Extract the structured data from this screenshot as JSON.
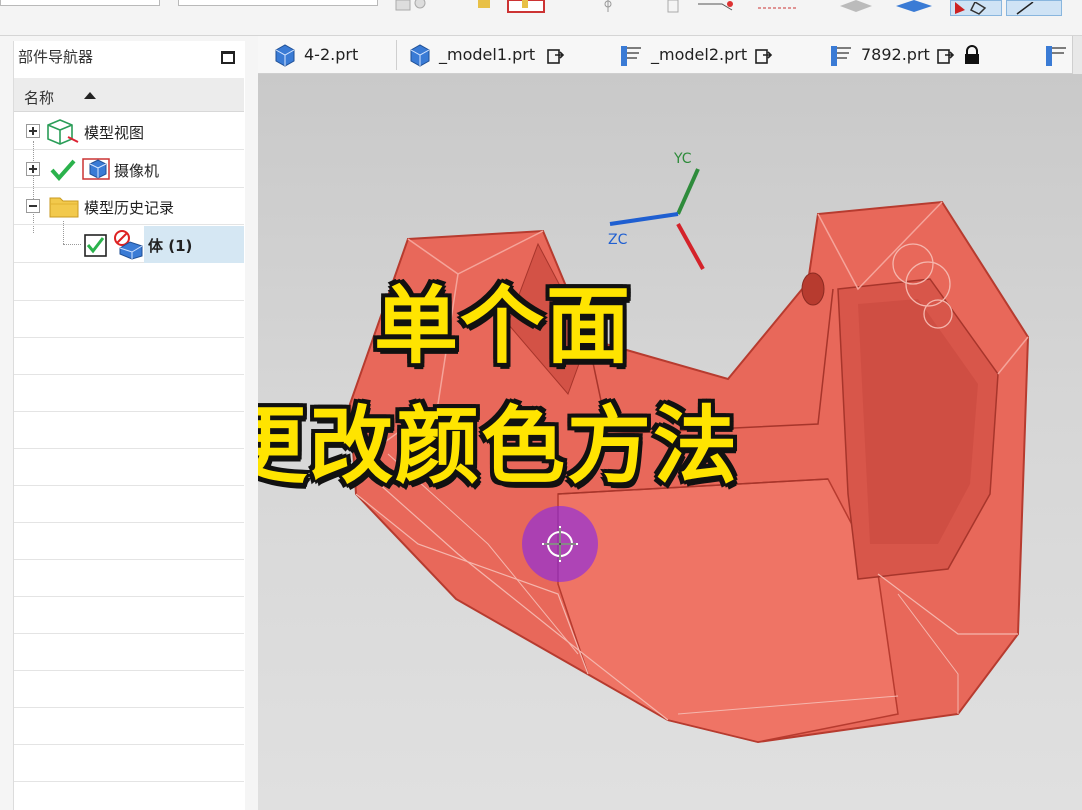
{
  "navigator": {
    "title": "部件导航器",
    "column_header": "名称",
    "tree": [
      {
        "label": "模型视图",
        "expander": "+"
      },
      {
        "label": "摄像机",
        "expander": "+"
      },
      {
        "label": "模型历史记录",
        "expander": "−"
      },
      {
        "label": "体 (1)",
        "checked": true,
        "selected": true
      }
    ]
  },
  "tabs": [
    {
      "label": "4-2.prt"
    },
    {
      "label": "_model1.prt"
    },
    {
      "label": "_model2.prt"
    },
    {
      "label": "7892.prt",
      "locked": true
    }
  ],
  "viewport": {
    "axes": {
      "y": "YC",
      "z": "ZC"
    },
    "overlay_line1": "单个面",
    "overlay_line2": "更改颜色方法",
    "colors": {
      "model": "#e8685a",
      "overlay_text": "#ffe400",
      "cursor_highlight": "#8a2be2"
    }
  }
}
